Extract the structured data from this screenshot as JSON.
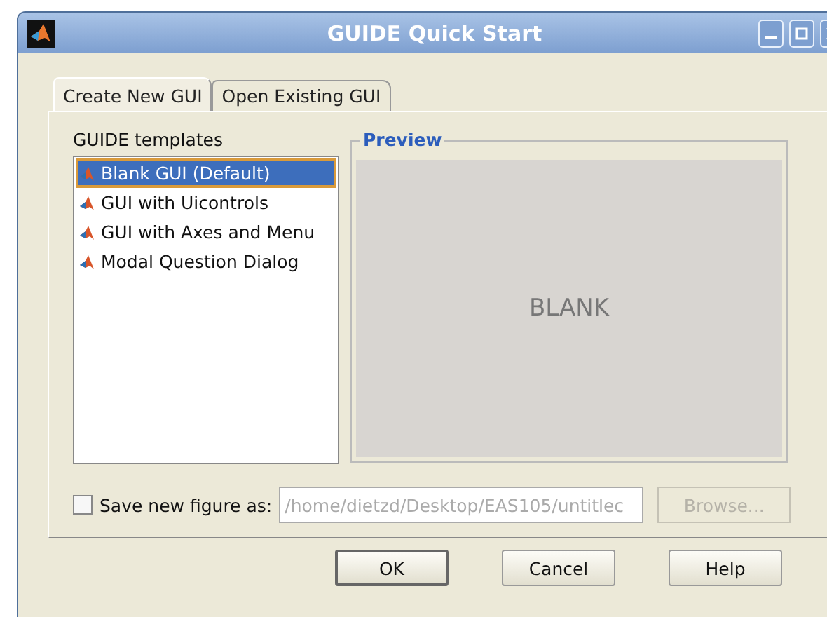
{
  "window": {
    "title": "GUIDE Quick Start"
  },
  "tabs": [
    {
      "label": "Create New GUI",
      "selected": true
    },
    {
      "label": "Open Existing GUI",
      "selected": false
    }
  ],
  "templates": {
    "label": "GUIDE templates",
    "items": [
      {
        "label": "Blank GUI (Default)",
        "selected": true
      },
      {
        "label": "GUI with Uicontrols",
        "selected": false
      },
      {
        "label": "GUI with Axes and Menu",
        "selected": false
      },
      {
        "label": "Modal Question Dialog",
        "selected": false
      }
    ]
  },
  "preview": {
    "label": "Preview",
    "text": "BLANK"
  },
  "save": {
    "label": "Save new figure as:",
    "checked": false,
    "value": "/home/dietzd/Desktop/EAS105/untitlec",
    "disabled": true,
    "browse": "Browse..."
  },
  "buttons": [
    {
      "label": "OK",
      "default": true
    },
    {
      "label": "Cancel",
      "default": false
    },
    {
      "label": "Help",
      "default": false
    }
  ]
}
